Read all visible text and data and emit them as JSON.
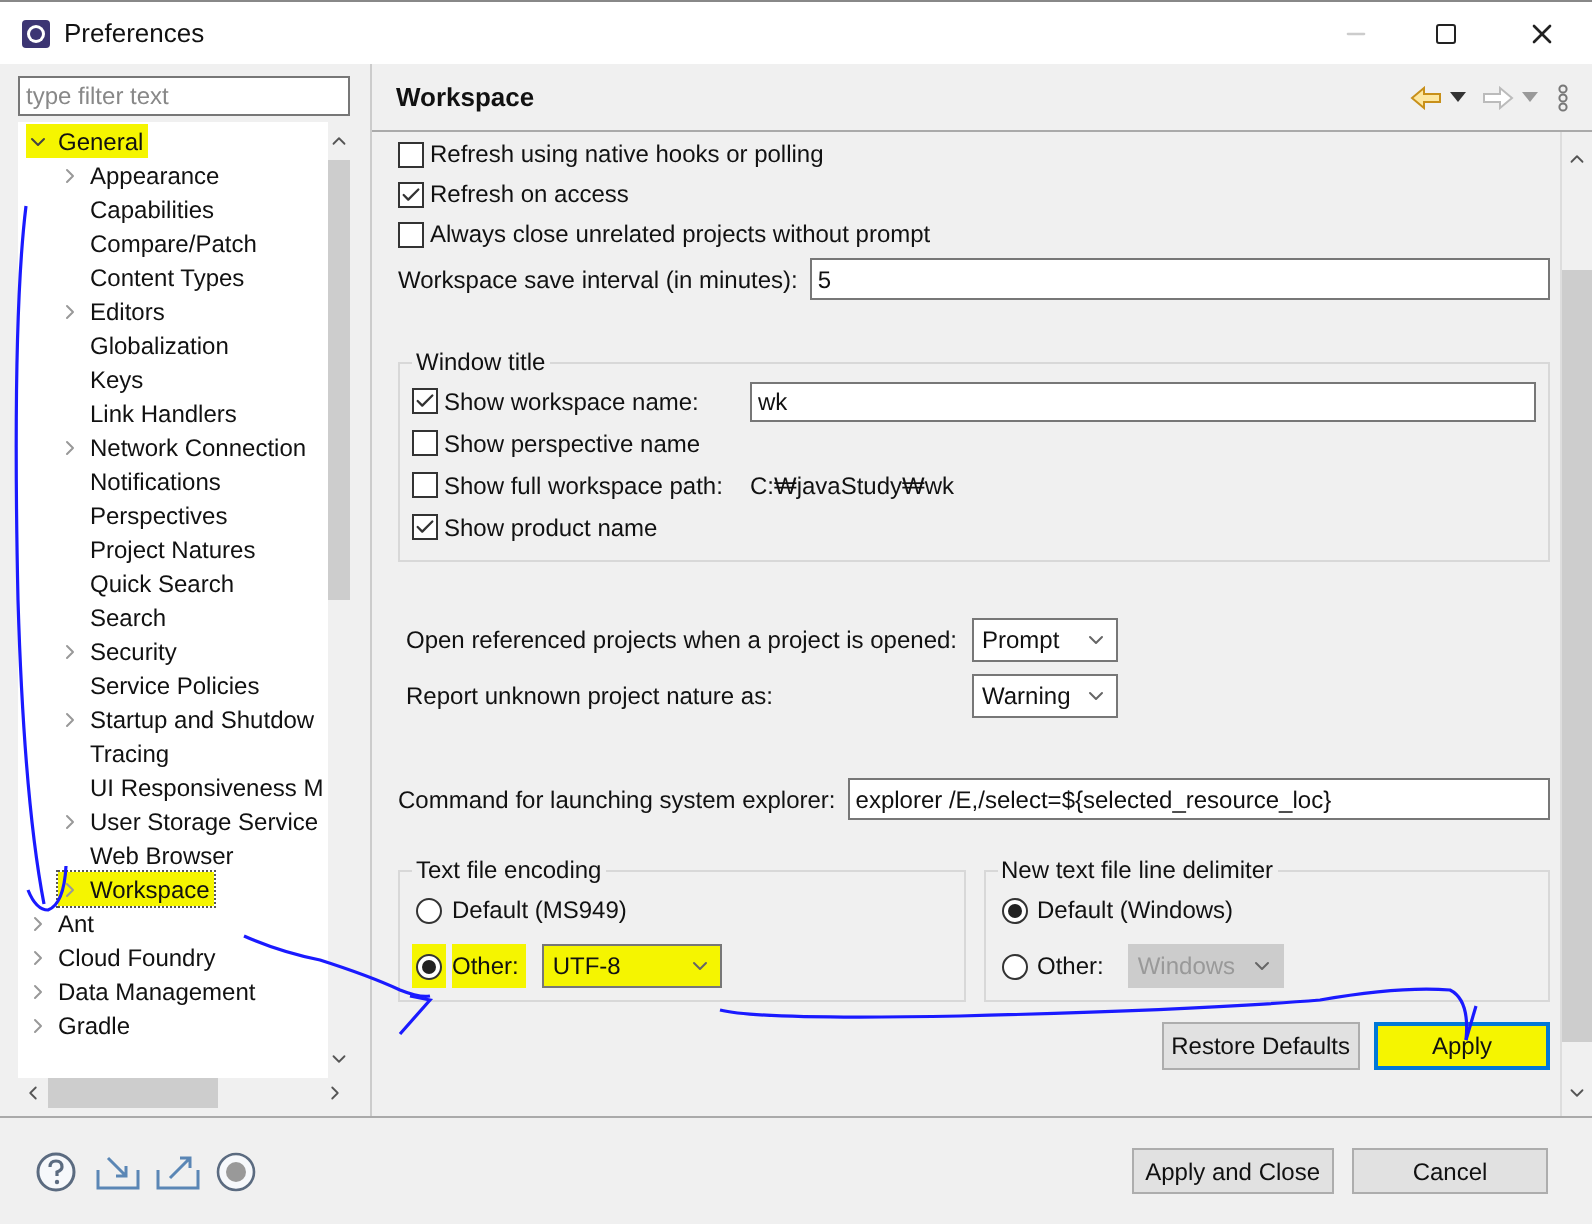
{
  "window": {
    "title": "Preferences"
  },
  "filter": {
    "placeholder": "type filter text"
  },
  "tree": [
    {
      "label": "General",
      "expandable": true,
      "expanded": true,
      "selected": false,
      "highlighted": true,
      "children": [
        {
          "label": "Appearance",
          "expandable": true,
          "expanded": false,
          "selected": false,
          "highlighted": false
        },
        {
          "label": "Capabilities",
          "expandable": false,
          "selected": false,
          "highlighted": false
        },
        {
          "label": "Compare/Patch",
          "expandable": false,
          "selected": false,
          "highlighted": false
        },
        {
          "label": "Content Types",
          "expandable": false,
          "selected": false,
          "highlighted": false
        },
        {
          "label": "Editors",
          "expandable": true,
          "expanded": false,
          "selected": false,
          "highlighted": false
        },
        {
          "label": "Globalization",
          "expandable": false,
          "selected": false,
          "highlighted": false
        },
        {
          "label": "Keys",
          "expandable": false,
          "selected": false,
          "highlighted": false
        },
        {
          "label": "Link Handlers",
          "expandable": false,
          "selected": false,
          "highlighted": false
        },
        {
          "label": "Network Connection",
          "expandable": true,
          "expanded": false,
          "selected": false,
          "highlighted": false
        },
        {
          "label": "Notifications",
          "expandable": false,
          "selected": false,
          "highlighted": false
        },
        {
          "label": "Perspectives",
          "expandable": false,
          "selected": false,
          "highlighted": false
        },
        {
          "label": "Project Natures",
          "expandable": false,
          "selected": false,
          "highlighted": false
        },
        {
          "label": "Quick Search",
          "expandable": false,
          "selected": false,
          "highlighted": false
        },
        {
          "label": "Search",
          "expandable": false,
          "selected": false,
          "highlighted": false
        },
        {
          "label": "Security",
          "expandable": true,
          "expanded": false,
          "selected": false,
          "highlighted": false
        },
        {
          "label": "Service Policies",
          "expandable": false,
          "selected": false,
          "highlighted": false
        },
        {
          "label": "Startup and Shutdow",
          "expandable": true,
          "expanded": false,
          "selected": false,
          "highlighted": false
        },
        {
          "label": "Tracing",
          "expandable": false,
          "selected": false,
          "highlighted": false
        },
        {
          "label": "UI Responsiveness M",
          "expandable": false,
          "selected": false,
          "highlighted": false
        },
        {
          "label": "User Storage Service",
          "expandable": true,
          "expanded": false,
          "selected": false,
          "highlighted": false
        },
        {
          "label": "Web Browser",
          "expandable": false,
          "selected": false,
          "highlighted": false
        },
        {
          "label": "Workspace",
          "expandable": true,
          "expanded": false,
          "selected": true,
          "highlighted": true
        }
      ]
    },
    {
      "label": "Ant",
      "expandable": true,
      "expanded": false,
      "selected": false,
      "highlighted": false
    },
    {
      "label": "Cloud Foundry",
      "expandable": true,
      "expanded": false,
      "selected": false,
      "highlighted": false
    },
    {
      "label": "Data Management",
      "expandable": true,
      "expanded": false,
      "selected": false,
      "highlighted": false
    },
    {
      "label": "Gradle",
      "expandable": true,
      "expanded": false,
      "selected": false,
      "highlighted": false
    }
  ],
  "page": {
    "title": "Workspace"
  },
  "options": [
    {
      "label": "Refresh using native hooks or polling",
      "checked": false
    },
    {
      "label": "Refresh on access",
      "checked": true
    },
    {
      "label": "Always close unrelated projects without prompt",
      "checked": false
    }
  ],
  "save_interval": {
    "label": "Workspace save interval (in minutes):",
    "value": "5"
  },
  "window_title": {
    "title": "Window title",
    "rows": [
      {
        "kind": "field",
        "label": "Show workspace name:",
        "checked": true,
        "value": "wk"
      },
      {
        "kind": "plain",
        "label": "Show perspective name",
        "checked": false
      },
      {
        "kind": "path",
        "label": "Show full workspace path:",
        "checked": false,
        "value": "C:₩javaStudy₩wk"
      },
      {
        "kind": "plain",
        "label": "Show product name",
        "checked": true
      }
    ]
  },
  "dropdowns": [
    {
      "label": "Open referenced projects when a project is opened:",
      "value": "Prompt"
    },
    {
      "label": "Report unknown project nature as:",
      "value": "Warning"
    }
  ],
  "explorer": {
    "label": "Command for launching system explorer:",
    "value": "explorer /E,/select=${selected_resource_loc}"
  },
  "encoding": {
    "title": "Text file encoding",
    "options": [
      {
        "label": "Default (MS949)",
        "selected": false,
        "highlighted": false
      },
      {
        "label": "Other:",
        "selected": true,
        "highlighted": true
      }
    ],
    "value": "UTF-8",
    "disabled": false,
    "highlighted": true
  },
  "delimiter": {
    "title": "New text file line delimiter",
    "options": [
      {
        "label": "Default (Windows)",
        "selected": true,
        "highlighted": false
      },
      {
        "label": "Other:",
        "selected": false,
        "highlighted": false
      }
    ],
    "value": "Windows",
    "disabled": true
  },
  "page_buttons": [
    {
      "label": "Restore Defaults",
      "highlighted": false
    },
    {
      "label": "Apply",
      "highlighted": true
    }
  ],
  "dialog_buttons": [
    {
      "label": "Apply and Close"
    },
    {
      "label": "Cancel"
    }
  ]
}
